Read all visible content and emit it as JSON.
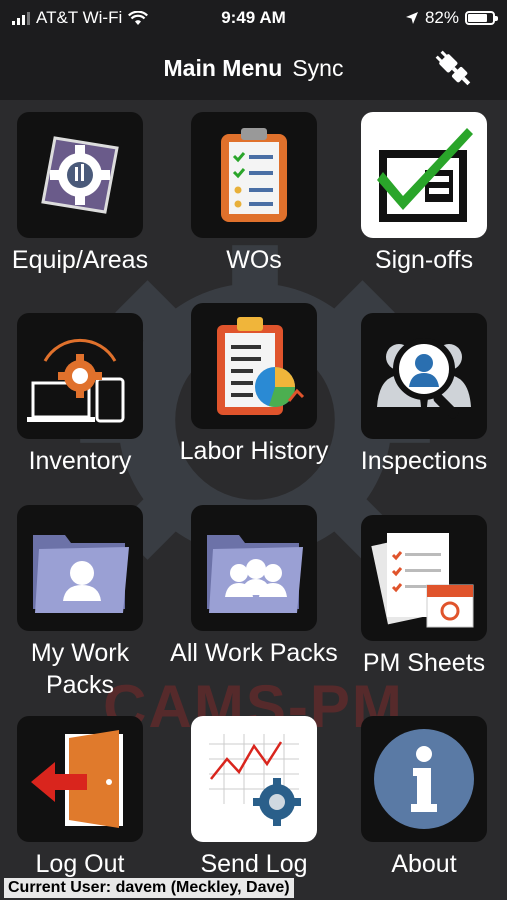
{
  "status_bar": {
    "carrier": "AT&T Wi-Fi",
    "time": "9:49 AM",
    "battery_percent": "82%",
    "battery_level": 0.82
  },
  "nav": {
    "title": "Main Menu",
    "sync_label": "Sync",
    "plug_icon": "plug-icon"
  },
  "watermark": "CAMS-PM",
  "menu": {
    "equip_areas": "Equip/Areas",
    "wos": "WOs",
    "sign_offs": "Sign-offs",
    "inventory": "Inventory",
    "labor_history": "Labor History",
    "inspections": "Inspections",
    "my_work_packs": "My Work Packs",
    "all_work_packs": "All Work Packs",
    "pm_sheets": "PM Sheets",
    "log_out": "Log Out",
    "send_log": "Send Log",
    "about": "About"
  },
  "footer": {
    "current_user": "Current User: davem (Meckley, Dave)"
  },
  "colors": {
    "background": "#2b2b2d",
    "bar": "#1c1c1e",
    "check_green": "#2aa52a",
    "clipboard_orange": "#e0712c",
    "folder_blue": "#8e95c9",
    "logout_red": "#d9251d",
    "door_orange": "#e07a2c",
    "about_blue": "#5a7aa5"
  }
}
